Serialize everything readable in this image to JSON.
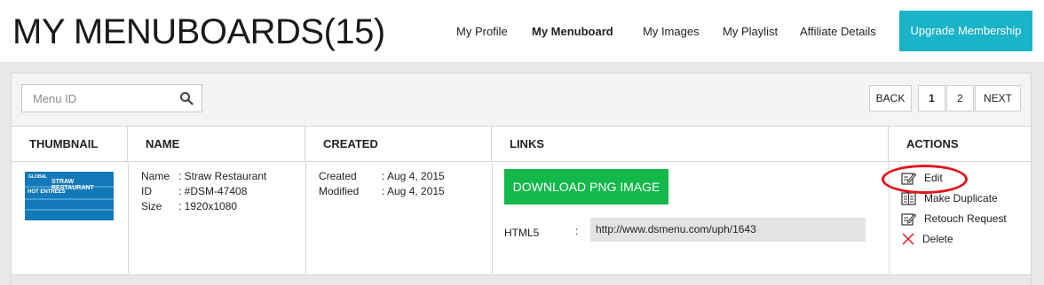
{
  "header": {
    "title": "MY MENUBOARDS(15)",
    "nav": [
      {
        "label": "My Profile"
      },
      {
        "label": "My Menuboard"
      },
      {
        "label": "My Images"
      },
      {
        "label": "My Playlist"
      },
      {
        "label": "Affiliate Details"
      }
    ],
    "upgrade_label": "Upgrade Membership"
  },
  "search": {
    "placeholder": "Menu ID",
    "value": ""
  },
  "pagination": {
    "back": "BACK",
    "pages": [
      "1",
      "2"
    ],
    "next": "NEXT",
    "current": "1"
  },
  "table": {
    "columns": [
      "THUMBNAIL",
      "NAME",
      "CREATED",
      "LINKS",
      "ACTIONS"
    ],
    "row": {
      "thumbnail_text": [
        "GLOBAL",
        "STRAW RESTAURANT",
        "HOT ENTREES"
      ],
      "name": [
        {
          "label": "Name",
          "value": ": Straw Restaurant"
        },
        {
          "label": "ID",
          "value": ": #DSM-47408"
        },
        {
          "label": "Size",
          "value": ": 1920x1080"
        }
      ],
      "created": [
        {
          "label": "Created",
          "value": ": Aug 4, 2015"
        },
        {
          "label": "Modified",
          "value": ": Aug 4, 2015"
        }
      ],
      "links": {
        "download_label": "DOWNLOAD PNG IMAGE",
        "html5_label": "HTML5",
        "html5_colon": ":",
        "html5_url": "http://www.dsmenu.com/uph/1643"
      },
      "actions": [
        {
          "label": "Edit",
          "icon": "edit-icon"
        },
        {
          "label": "Make Duplicate",
          "icon": "duplicate-icon"
        },
        {
          "label": "Retouch Request",
          "icon": "retouch-icon"
        },
        {
          "label": "Delete",
          "icon": "delete-icon"
        }
      ]
    }
  },
  "colors": {
    "accent": "#1ab3c8",
    "download": "#12b94a",
    "highlight": "#e0161e",
    "delete": "#e0161e"
  }
}
